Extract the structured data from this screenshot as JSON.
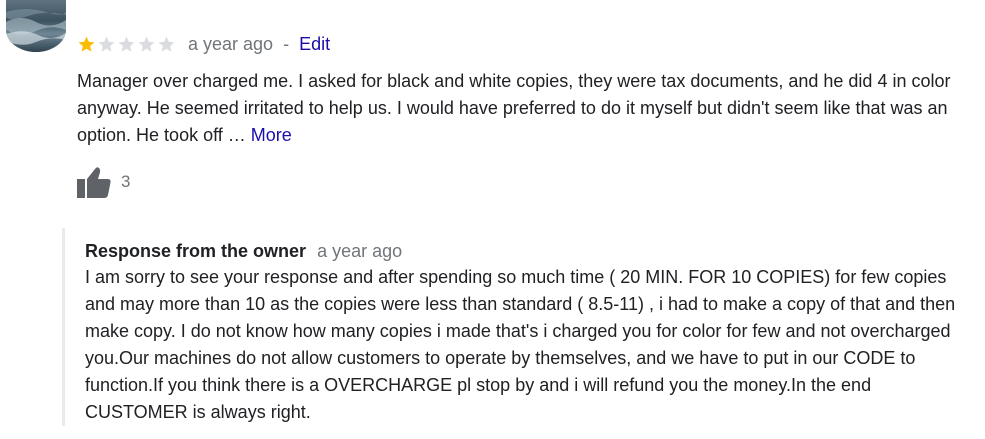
{
  "review": {
    "rating": 1,
    "rating_max": 5,
    "star_color_filled": "#fbbc04",
    "star_color_empty": "#dadce0",
    "time_ago": "a year ago",
    "separator": "-",
    "edit_label": "Edit",
    "text": "Manager over charged me. I asked for black and white copies, they were tax documents, and he did 4 in color anyway. He seemed irritated to help us. I would have preferred to do it myself but didn't seem like that was an option. He took off …",
    "more_label": "More",
    "like_count": "3"
  },
  "owner_response": {
    "title": "Response from the owner",
    "time_ago": "a year ago",
    "text": "I am sorry to see your response and after spending so much time ( 20 MIN. FOR 10 COPIES) for few copies and may more than 10 as the copies were less than standard ( 8.5-11) , i had to make a copy of that and then make copy. I do not know how many copies i made that's i charged you for color for few and not overcharged you.Our machines do not allow customers to operate by themselves, and we have to put in our CODE to function.If you think there is a OVERCHARGE pl stop by and i will refund you the money.In the end CUSTOMER is always right."
  },
  "colors": {
    "link": "#1a0dab",
    "secondary_text": "#70757a",
    "response_border": "#e8eaed"
  }
}
